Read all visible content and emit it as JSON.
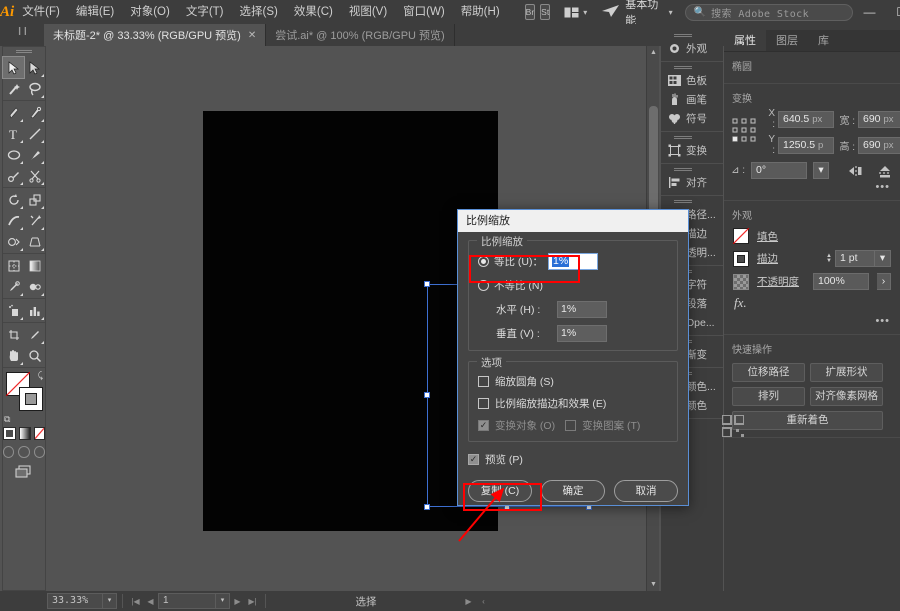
{
  "app": {
    "logo": "Ai"
  },
  "menubar": {
    "items": [
      {
        "label": "文件(F)",
        "name": "menu-file"
      },
      {
        "label": "编辑(E)",
        "name": "menu-edit"
      },
      {
        "label": "对象(O)",
        "name": "menu-object"
      },
      {
        "label": "文字(T)",
        "name": "menu-type"
      },
      {
        "label": "选择(S)",
        "name": "menu-select"
      },
      {
        "label": "效果(C)",
        "name": "menu-effect"
      },
      {
        "label": "视图(V)",
        "name": "menu-view"
      },
      {
        "label": "窗口(W)",
        "name": "menu-window"
      },
      {
        "label": "帮助(H)",
        "name": "menu-help"
      }
    ],
    "bridge_label": "Br",
    "stock_label": "St",
    "workspace": "基本功能",
    "search_placeholder": "搜索 Adobe Stock",
    "window_controls": {
      "minimize": "—",
      "maximize": "☐",
      "close": "✕"
    }
  },
  "tabs": [
    {
      "label": "未标题-2* @ 33.33% (RGB/GPU 预览)",
      "active": true,
      "close": "✕"
    },
    {
      "label": "尝试.ai* @ 100% (RGB/GPU 预览)",
      "active": false,
      "close": ""
    }
  ],
  "toolbar": {
    "tools": [
      "selection-tool",
      "direct-selection-tool",
      "magic-wand-tool",
      "lasso-tool",
      "pen-tool",
      "curvature-tool",
      "type-tool",
      "line-segment-tool",
      "ellipse-tool",
      "paintbrush-tool",
      "pencil-tool",
      "scissors-tool",
      "rotate-tool",
      "scale-tool",
      "width-tool",
      "free-transform-tool",
      "shape-builder-tool",
      "perspective-grid-tool",
      "mesh-tool",
      "gradient-tool",
      "eyedropper-tool",
      "blend-tool",
      "symbol-sprayer-tool",
      "column-graph-tool",
      "artboard-tool",
      "slice-tool",
      "hand-tool",
      "zoom-tool"
    ],
    "fill_label": "fill-swatch",
    "stroke_label": "stroke-swatch",
    "color_modes": [
      "color-mode-solid",
      "color-mode-gradient",
      "color-mode-none"
    ],
    "draw_modes": [
      "draw-normal",
      "draw-behind",
      "draw-inside"
    ],
    "screen_mode": "screen-mode-toggle"
  },
  "canvas": {
    "artboard_fill": "#030303",
    "selection_color": "#3d6fd1",
    "background": "#535353"
  },
  "dock": {
    "sections": [
      {
        "items": [
          {
            "label": "外观",
            "icon": "appearance-icon"
          }
        ]
      },
      {
        "items": [
          {
            "label": "色板",
            "icon": "swatches-icon"
          },
          {
            "label": "画笔",
            "icon": "brushes-icon"
          },
          {
            "label": "符号",
            "icon": "symbols-icon"
          }
        ]
      },
      {
        "items": [
          {
            "label": "变换",
            "icon": "transform-icon"
          }
        ]
      },
      {
        "items": [
          {
            "label": "对齐",
            "icon": "align-icon"
          }
        ]
      },
      {
        "items": [
          {
            "label": "路径...",
            "icon": "pathfinder-icon"
          },
          {
            "label": "描边",
            "icon": "stroke-icon"
          },
          {
            "label": "透明...",
            "icon": "transparency-icon"
          }
        ]
      },
      {
        "items": [
          {
            "label": "字符",
            "icon": "character-icon"
          },
          {
            "label": "段落",
            "icon": "paragraph-icon"
          },
          {
            "label": "Ope...",
            "icon": "opentype-icon"
          }
        ]
      },
      {
        "items": [
          {
            "label": "渐变",
            "icon": "gradient-icon"
          }
        ]
      },
      {
        "items": [
          {
            "label": "颜色...",
            "icon": "color-guide-icon"
          },
          {
            "label": "颜色",
            "icon": "color-icon"
          }
        ]
      }
    ]
  },
  "properties": {
    "tabs": [
      {
        "label": "属性",
        "active": true
      },
      {
        "label": "图层",
        "active": false
      },
      {
        "label": "库",
        "active": false
      }
    ],
    "object_type": "椭圆",
    "transform": {
      "title": "变换",
      "x_label": "X :",
      "x_value": "640.5",
      "x_unit": "px",
      "y_label": "Y :",
      "y_value": "1250.5",
      "y_unit": "p",
      "w_label": "宽 :",
      "w_value": "690",
      "w_unit": "px",
      "h_label": "高 :",
      "h_value": "690",
      "h_unit": "px",
      "angle_label": "⊿ :",
      "angle_value": "0°",
      "link_icon": "link-broken-icon",
      "flip_h_icon": "flip-horizontal-icon",
      "flip_v_icon": "flip-vertical-icon",
      "more_icon": "more-options-icon"
    },
    "appearance": {
      "title": "外观",
      "fill_label": "填色",
      "stroke_label": "描边",
      "stroke_weight": "1 pt",
      "opacity_label": "不透明度",
      "opacity_value": "100%",
      "fx_label": "fx.",
      "more_icon": "more-options-icon"
    },
    "quick_actions": {
      "title": "快速操作",
      "buttons": [
        "位移路径",
        "扩展形状",
        "排列",
        "对齐像素网格",
        "重新着色"
      ]
    }
  },
  "dialog": {
    "title": "比例缩放",
    "group_scale_label": "比例缩放",
    "uniform_label": "等比 (U)：",
    "uniform_value": "1%",
    "uniform_selected": true,
    "non_uniform_label": "不等比 (N)",
    "horizontal_label": "水平 (H) :",
    "horizontal_value": "1%",
    "vertical_label": "垂直 (V) :",
    "vertical_value": "1%",
    "group_options_label": "选项",
    "option_round_corners": "缩放圆角 (S)",
    "option_round_corners_checked": false,
    "option_strokes_effects": "比例缩放描边和效果 (E)",
    "option_strokes_effects_checked": false,
    "option_transform_objects": "变换对象 (O)",
    "option_transform_objects_checked": true,
    "option_transform_patterns": "变换图案 (T)",
    "option_transform_patterns_checked": false,
    "preview_label": "预览 (P)",
    "preview_checked": true,
    "buttons": {
      "copy": "复制 (C)",
      "ok": "确定",
      "cancel": "取消"
    },
    "highlight_color": "#ff0000"
  },
  "statusbar": {
    "zoom": "33.33%",
    "page": "1",
    "tool": "选择",
    "first_icon": "first-page-icon",
    "prev_icon": "prev-page-icon",
    "next_icon": "next-page-icon",
    "last_icon": "last-page-icon"
  }
}
